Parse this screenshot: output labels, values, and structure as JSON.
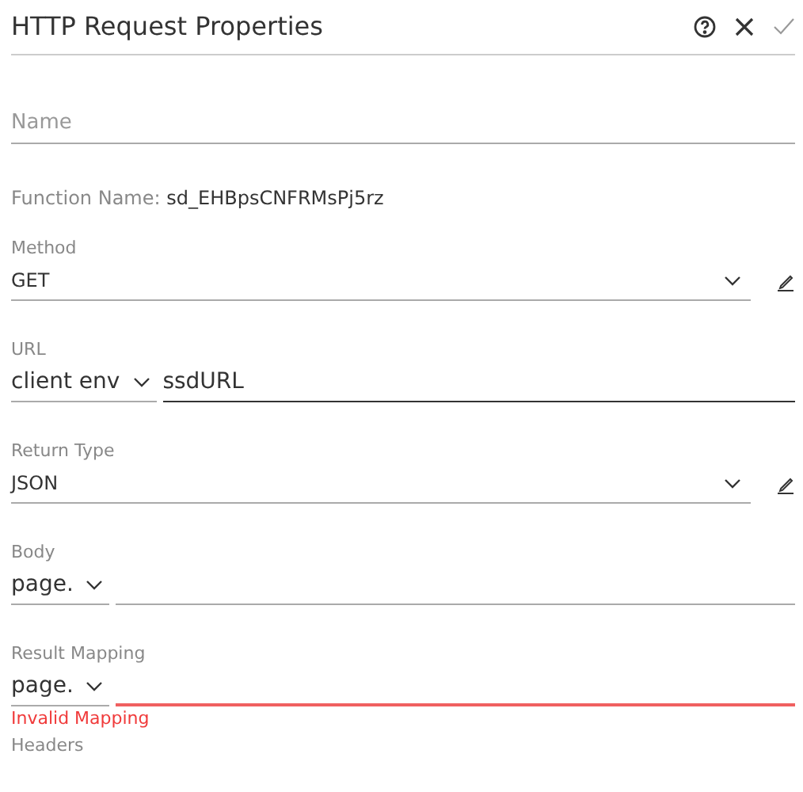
{
  "header": {
    "title": "HTTP Request Properties",
    "actions": [
      {
        "kind": "help"
      },
      {
        "kind": "close"
      },
      {
        "kind": "confirm"
      }
    ]
  },
  "fields": [
    {
      "kind": "text",
      "placeholder": "Name"
    },
    {
      "kind": "info",
      "label": "Function Name:",
      "value": "sd_EHBpsCNFRMsPj5rz"
    },
    {
      "kind": "select",
      "label": "Method",
      "value": "GET",
      "editable": true
    },
    {
      "kind": "prefixed",
      "label": "URL",
      "prefix": "client env",
      "value": "ssdURL",
      "focused": true
    },
    {
      "kind": "select",
      "label": "Return Type",
      "value": "JSON",
      "editable": true
    },
    {
      "kind": "prefixed",
      "label": "Body",
      "prefix": "page.",
      "focused": false
    },
    {
      "kind": "prefixed",
      "label": "Result Mapping",
      "prefix": "page.",
      "error": "Invalid Mapping"
    },
    {
      "kind": "heading",
      "label": "Headers"
    }
  ]
}
